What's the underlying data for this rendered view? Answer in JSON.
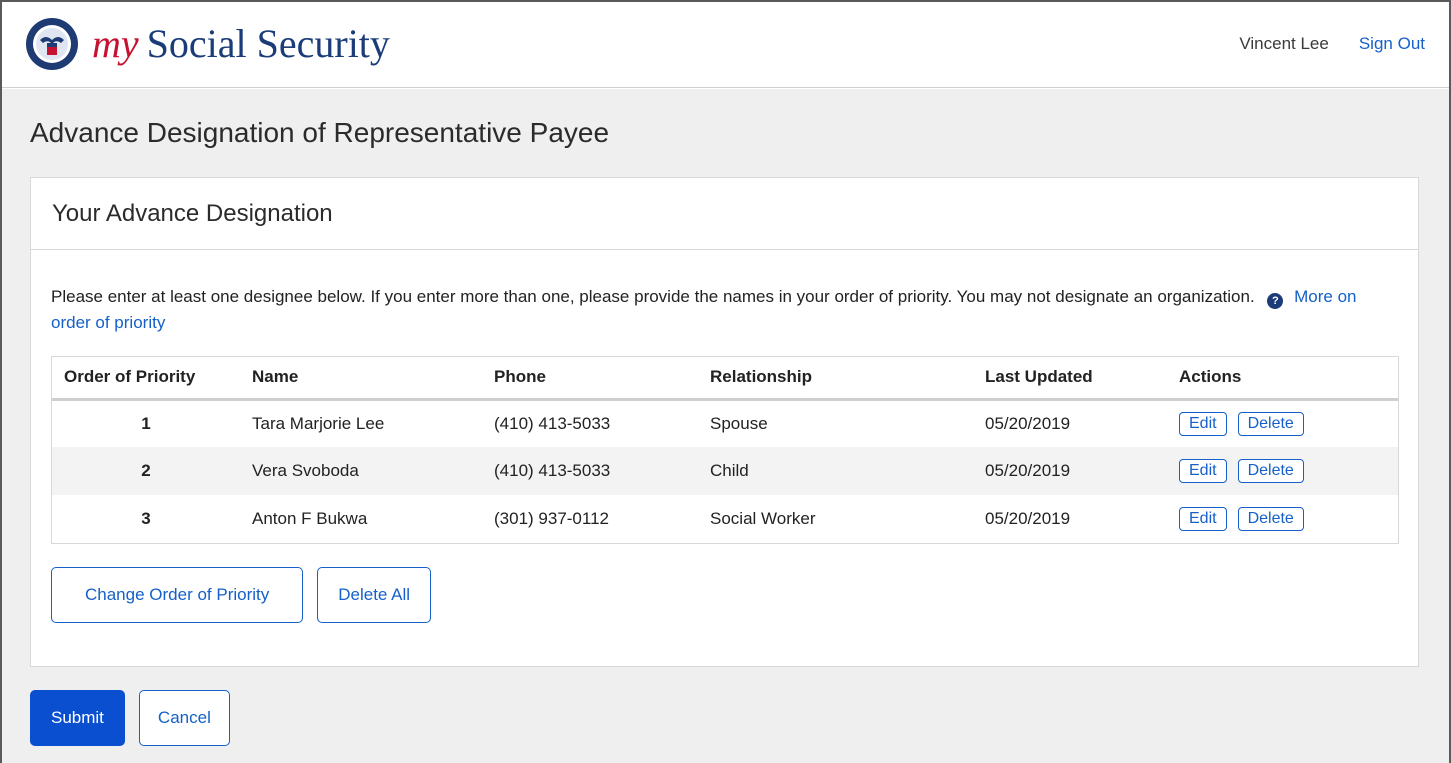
{
  "header": {
    "brand_prefix": "my",
    "brand_name": "Social Security",
    "user_name": "Vincent Lee",
    "sign_out_label": "Sign Out",
    "logo_icon": "ssa-seal-icon"
  },
  "page": {
    "title": "Advance Designation of Representative Payee"
  },
  "card": {
    "title": "Your Advance Designation",
    "instructions": "Please enter at least one designee below. If you enter more than one, please provide the names in your order of priority. You may not designate an organization.",
    "help_icon": "question-circle-icon",
    "help_link": "More on order of priority"
  },
  "table": {
    "headers": [
      "Order of Priority",
      "Name",
      "Phone",
      "Relationship",
      "Last Updated",
      "Actions"
    ],
    "rows": [
      {
        "priority": "1",
        "name": "Tara Marjorie Lee",
        "phone": "(410) 413-5033",
        "relationship": "Spouse",
        "last_updated": "05/20/2019",
        "edit": "Edit",
        "delete": "Delete"
      },
      {
        "priority": "2",
        "name": "Vera Svoboda",
        "phone": "(410) 413-5033",
        "relationship": "Child",
        "last_updated": "05/20/2019",
        "edit": "Edit",
        "delete": "Delete"
      },
      {
        "priority": "3",
        "name": "Anton F Bukwa",
        "phone": "(301) 937-0112",
        "relationship": "Social Worker",
        "last_updated": "05/20/2019",
        "edit": "Edit",
        "delete": "Delete"
      }
    ]
  },
  "card_actions": {
    "change_order_label": "Change Order of Priority",
    "delete_all_label": "Delete All"
  },
  "page_actions": {
    "submit_label": "Submit",
    "cancel_label": "Cancel"
  },
  "colors": {
    "brand_blue": "#1b3c78",
    "brand_red": "#c41230",
    "link_blue": "#1560c9",
    "primary_button": "#0b4fd1",
    "page_background": "#efefef"
  }
}
